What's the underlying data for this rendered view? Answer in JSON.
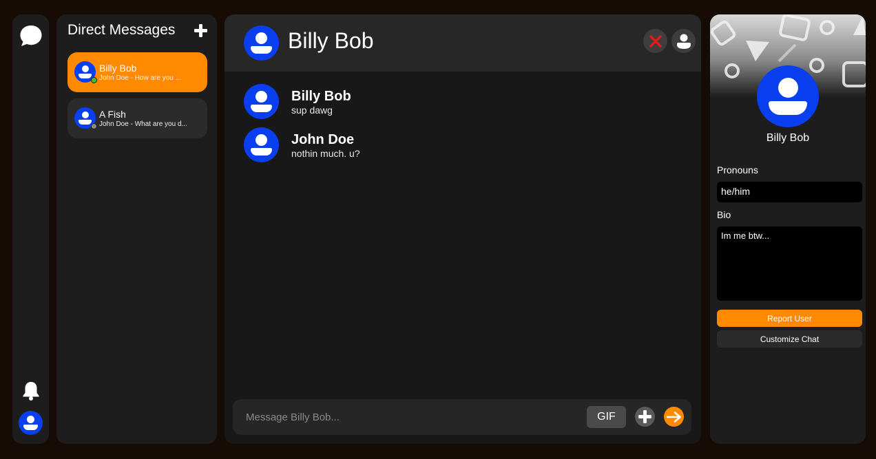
{
  "rail": {
    "icons": [
      "chat-bubble-icon",
      "bell-icon",
      "user-avatar-icon"
    ]
  },
  "dm_list": {
    "title": "Direct Messages",
    "items": [
      {
        "name": "Billy Bob",
        "preview": "John Doe - How are you ...",
        "status": "online",
        "status_color": "#3ec41e",
        "active": true
      },
      {
        "name": "A Fish",
        "preview": "John Doe - What are you d...",
        "status": "offline",
        "status_color": "#8a8a8a",
        "active": false
      }
    ]
  },
  "chat": {
    "title": "Billy Bob",
    "messages": [
      {
        "author": "Billy Bob",
        "text": "sup dawg"
      },
      {
        "author": "John Doe",
        "text": "nothin much. u?"
      }
    ],
    "composer": {
      "placeholder": "Message Billy Bob...",
      "gif_label": "GIF"
    }
  },
  "profile": {
    "name": "Billy Bob",
    "pronouns_label": "Pronouns",
    "pronouns": "he/him",
    "bio_label": "Bio",
    "bio": "Im me btw...",
    "report_label": "Report User",
    "customize_label": "Customize Chat"
  },
  "colors": {
    "accent": "#ff8a00",
    "avatar": "#0a3ff0",
    "background": "#160b05",
    "panel": "#1d1d1d",
    "close_x": "#e01b1b"
  }
}
